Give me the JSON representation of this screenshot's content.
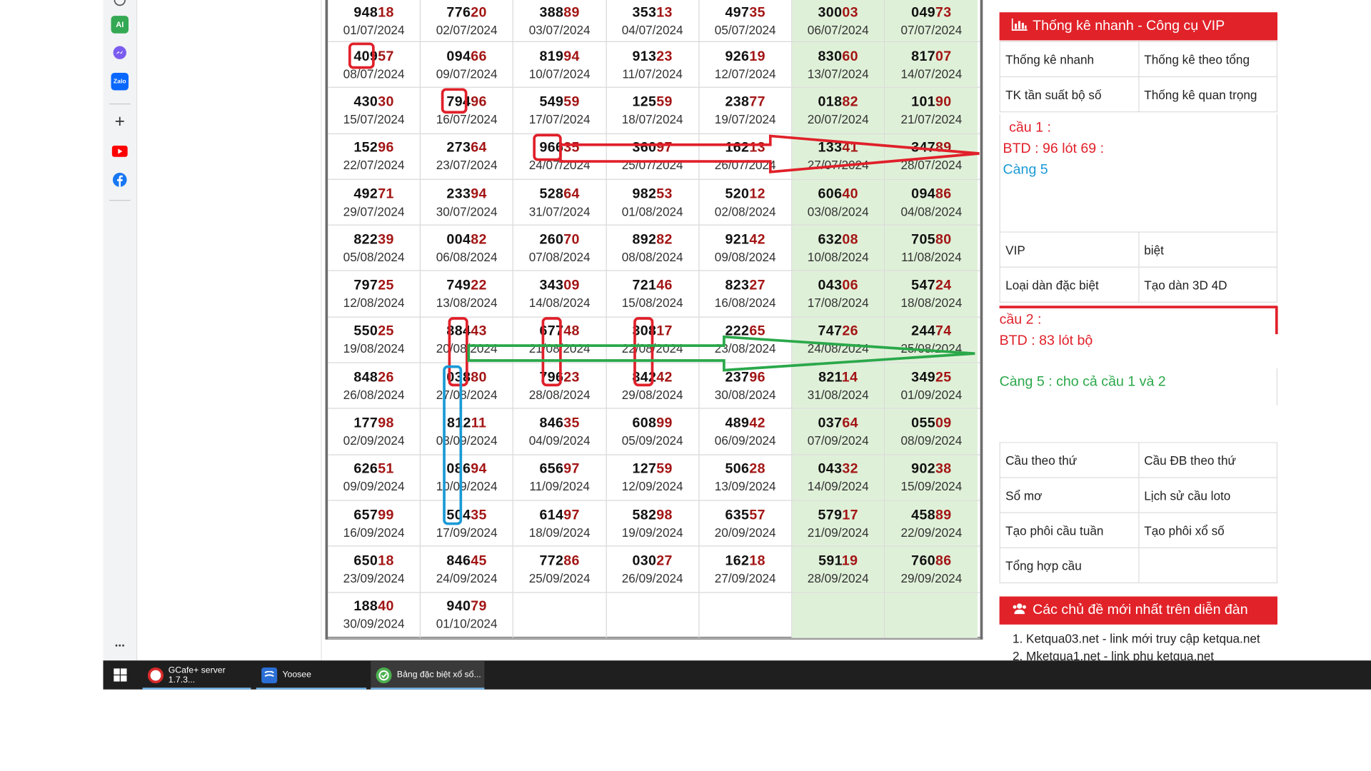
{
  "sidebar": {
    "icons": [
      "ai-icon",
      "messenger-icon",
      "zalo-icon",
      "add-icon",
      "youtube-icon",
      "facebook-icon",
      "more-icon"
    ],
    "ai_label": "AI",
    "zalo_label": "Zalo",
    "plus_label": "+",
    "more_label": "..."
  },
  "table": {
    "rows": [
      [
        [
          "948",
          "18",
          "01/07/2024"
        ],
        [
          "776",
          "20",
          "02/07/2024"
        ],
        [
          "388",
          "89",
          "03/07/2024"
        ],
        [
          "353",
          "13",
          "04/07/2024"
        ],
        [
          "497",
          "35",
          "05/07/2024"
        ],
        [
          "300",
          "03",
          "06/07/2024"
        ],
        [
          "049",
          "73",
          "07/07/2024"
        ]
      ],
      [
        [
          "409",
          "57",
          "08/07/2024"
        ],
        [
          "094",
          "66",
          "09/07/2024"
        ],
        [
          "819",
          "94",
          "10/07/2024"
        ],
        [
          "913",
          "23",
          "11/07/2024"
        ],
        [
          "926",
          "19",
          "12/07/2024"
        ],
        [
          "830",
          "60",
          "13/07/2024"
        ],
        [
          "817",
          "07",
          "14/07/2024"
        ]
      ],
      [
        [
          "430",
          "30",
          "15/07/2024"
        ],
        [
          "794",
          "96",
          "16/07/2024"
        ],
        [
          "549",
          "59",
          "17/07/2024"
        ],
        [
          "125",
          "59",
          "18/07/2024"
        ],
        [
          "238",
          "77",
          "19/07/2024"
        ],
        [
          "018",
          "82",
          "20/07/2024"
        ],
        [
          "101",
          "90",
          "21/07/2024"
        ]
      ],
      [
        [
          "152",
          "96",
          "22/07/2024"
        ],
        [
          "273",
          "64",
          "23/07/2024"
        ],
        [
          "966",
          "35",
          "24/07/2024"
        ],
        [
          "360",
          "97",
          "25/07/2024"
        ],
        [
          "162",
          "13",
          "26/07/2024"
        ],
        [
          "133",
          "41",
          "27/07/2024"
        ],
        [
          "347",
          "89",
          "28/07/2024"
        ]
      ],
      [
        [
          "492",
          "71",
          "29/07/2024"
        ],
        [
          "233",
          "94",
          "30/07/2024"
        ],
        [
          "528",
          "64",
          "31/07/2024"
        ],
        [
          "982",
          "53",
          "01/08/2024"
        ],
        [
          "520",
          "12",
          "02/08/2024"
        ],
        [
          "606",
          "40",
          "03/08/2024"
        ],
        [
          "094",
          "86",
          "04/08/2024"
        ]
      ],
      [
        [
          "822",
          "39",
          "05/08/2024"
        ],
        [
          "004",
          "82",
          "06/08/2024"
        ],
        [
          "260",
          "70",
          "07/08/2024"
        ],
        [
          "892",
          "82",
          "08/08/2024"
        ],
        [
          "921",
          "42",
          "09/08/2024"
        ],
        [
          "632",
          "08",
          "10/08/2024"
        ],
        [
          "705",
          "80",
          "11/08/2024"
        ]
      ],
      [
        [
          "797",
          "25",
          "12/08/2024"
        ],
        [
          "749",
          "22",
          "13/08/2024"
        ],
        [
          "343",
          "09",
          "14/08/2024"
        ],
        [
          "721",
          "46",
          "15/08/2024"
        ],
        [
          "823",
          "27",
          "16/08/2024"
        ],
        [
          "043",
          "06",
          "17/08/2024"
        ],
        [
          "547",
          "24",
          "18/08/2024"
        ]
      ],
      [
        [
          "550",
          "25",
          "19/08/2024"
        ],
        [
          "884",
          "43",
          "20/08/2024"
        ],
        [
          "677",
          "48",
          "21/08/2024"
        ],
        [
          "308",
          "17",
          "22/08/2024"
        ],
        [
          "222",
          "65",
          "23/08/2024"
        ],
        [
          "747",
          "26",
          "24/08/2024"
        ],
        [
          "244",
          "74",
          "25/08/2024"
        ]
      ],
      [
        [
          "848",
          "26",
          "26/08/2024"
        ],
        [
          "038",
          "80",
          "27/08/2024"
        ],
        [
          "796",
          "23",
          "28/08/2024"
        ],
        [
          "842",
          "42",
          "29/08/2024"
        ],
        [
          "237",
          "96",
          "30/08/2024"
        ],
        [
          "821",
          "14",
          "31/08/2024"
        ],
        [
          "349",
          "25",
          "01/09/2024"
        ]
      ],
      [
        [
          "177",
          "98",
          "02/09/2024"
        ],
        [
          "812",
          "11",
          "03/09/2024"
        ],
        [
          "846",
          "35",
          "04/09/2024"
        ],
        [
          "608",
          "99",
          "05/09/2024"
        ],
        [
          "489",
          "42",
          "06/09/2024"
        ],
        [
          "037",
          "64",
          "07/09/2024"
        ],
        [
          "055",
          "09",
          "08/09/2024"
        ]
      ],
      [
        [
          "626",
          "51",
          "09/09/2024"
        ],
        [
          "086",
          "94",
          "10/09/2024"
        ],
        [
          "656",
          "97",
          "11/09/2024"
        ],
        [
          "127",
          "59",
          "12/09/2024"
        ],
        [
          "506",
          "28",
          "13/09/2024"
        ],
        [
          "043",
          "32",
          "14/09/2024"
        ],
        [
          "902",
          "38",
          "15/09/2024"
        ]
      ],
      [
        [
          "657",
          "99",
          "16/09/2024"
        ],
        [
          "504",
          "35",
          "17/09/2024"
        ],
        [
          "614",
          "97",
          "18/09/2024"
        ],
        [
          "582",
          "98",
          "19/09/2024"
        ],
        [
          "635",
          "57",
          "20/09/2024"
        ],
        [
          "579",
          "17",
          "21/09/2024"
        ],
        [
          "458",
          "89",
          "22/09/2024"
        ]
      ],
      [
        [
          "650",
          "18",
          "23/09/2024"
        ],
        [
          "846",
          "45",
          "24/09/2024"
        ],
        [
          "772",
          "86",
          "25/09/2024"
        ],
        [
          "030",
          "27",
          "26/09/2024"
        ],
        [
          "162",
          "18",
          "27/09/2024"
        ],
        [
          "591",
          "19",
          "28/09/2024"
        ],
        [
          "760",
          "86",
          "29/09/2024"
        ]
      ],
      [
        [
          "188",
          "40",
          "30/09/2024"
        ],
        [
          "940",
          "79",
          "01/10/2024"
        ],
        [
          "",
          "",
          ""
        ],
        [
          "",
          "",
          ""
        ],
        [
          "",
          "",
          ""
        ],
        [
          "",
          "",
          ""
        ],
        [
          "",
          "",
          ""
        ]
      ]
    ]
  },
  "right_panel": {
    "header_title": "Thống kê nhanh - Công cụ VIP",
    "links_top": [
      [
        "Thống kê nhanh",
        "Thống kê theo tổng"
      ],
      [
        "TK tần suất bộ số",
        "Thống kê quan trọng"
      ]
    ],
    "links_mid": [
      [
        "VIP",
        "biệt"
      ],
      [
        "Loại dàn đặc biệt",
        "Tạo dàn 3D 4D"
      ]
    ],
    "links_bottom": [
      [
        "Cầu theo thứ",
        "Cầu ĐB theo thứ"
      ],
      [
        "Sổ mơ",
        "Lịch sử cầu loto"
      ],
      [
        "Tạo phôi cầu tuần",
        "Tạo phôi xổ số"
      ],
      [
        "Tổng hợp cầu",
        ""
      ]
    ],
    "forum_title": "Các chủ đề mới nhất trên diễn đàn",
    "forum_items": [
      "1. Ketqua03.net - link mới truy cập ketqua.net",
      "2. Mketqua1.net - link phụ ketqua.net"
    ]
  },
  "annotations": {
    "cau1_title": "cầu 1 :",
    "cau1_line": "BTD : 96 lót 69 :",
    "cau1_cang": "Càng 5",
    "cau2_title": "cầu 2 :",
    "cau2_line": "BTD : 83 lót bộ",
    "cang_both": "Càng 5 : cho cả cầu 1 và 2",
    "red_color": "#e0202a",
    "blue_color": "#1a9ad6",
    "green_color": "#2aa84a"
  },
  "taskbar": {
    "items": [
      {
        "label": "GCafe+ server 1.7.3...",
        "icon": "gcafe-icon"
      },
      {
        "label": "Yoosee",
        "icon": "yoosee-icon"
      },
      {
        "label": "Bảng đặc biệt xổ số...",
        "icon": "chrome-icon"
      }
    ]
  }
}
